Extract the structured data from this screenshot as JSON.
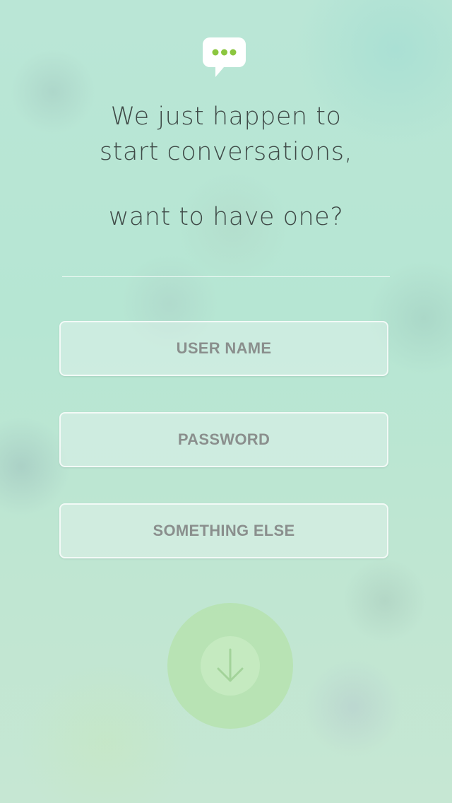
{
  "header": {
    "logo_icon": "chat-bubble-icon",
    "headline_lines": [
      "We just happen to",
      "start conversations,",
      "want to have one?"
    ]
  },
  "form": {
    "fields": [
      {
        "label": "USER NAME"
      },
      {
        "label": "PASSWORD"
      },
      {
        "label": "SOMETHING ELSE"
      }
    ],
    "submit_icon": "arrow-down-icon"
  },
  "colors": {
    "background": "#bfe5d6",
    "accent": "#8cc63f",
    "headline_text": "#3f4a47",
    "field_text": "#8a8f8d",
    "submit_circle": "#b4e1aa"
  }
}
